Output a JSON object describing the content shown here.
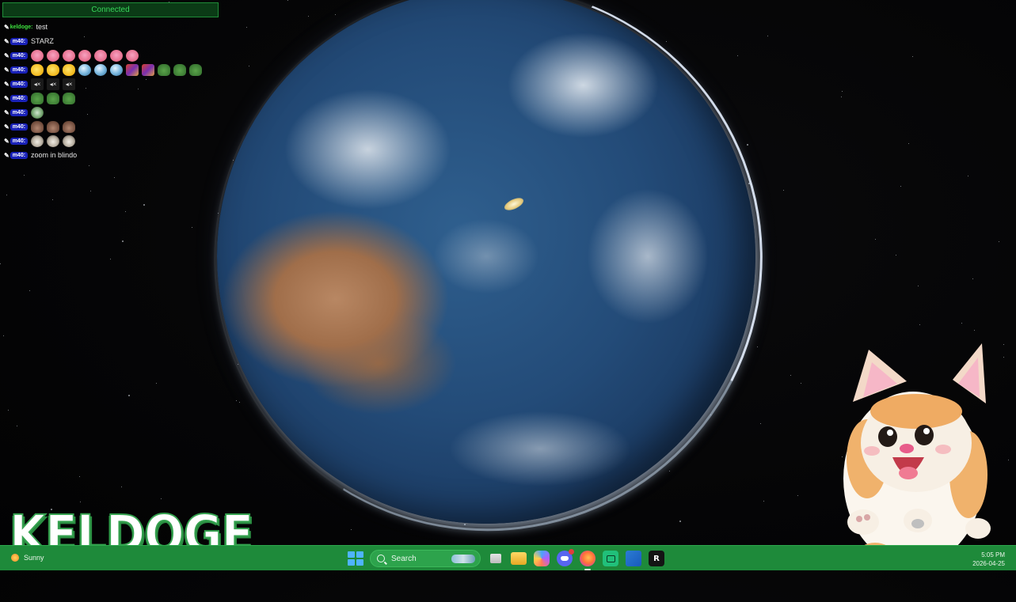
{
  "overlay": {
    "connection_status": "Connected",
    "messages": [
      {
        "user": "keldoge",
        "type": "text",
        "text": "test"
      },
      {
        "user": "m40",
        "type": "text",
        "text": "STARZ"
      },
      {
        "user": "m40",
        "type": "emotes",
        "emotes": [
          "kirby-emote",
          "kirby-emote",
          "kirby-emote",
          "kirby-emote",
          "kirby-emote",
          "kirby-emote",
          "kirby-emote"
        ]
      },
      {
        "user": "m40",
        "type": "emotes",
        "emotes": [
          "yellow-face-emote",
          "yellow-face-emote",
          "yellow-face-emote",
          "glass-sphere-emote",
          "glass-sphere-emote",
          "glass-sphere-emote",
          "mix-emote",
          "mix-emote",
          "frog-emote",
          "frog-emote",
          "frog-emote"
        ]
      },
      {
        "user": "m40",
        "type": "emotes",
        "emotes": [
          "mute-emote",
          "mute-emote",
          "mute-emote"
        ]
      },
      {
        "user": "m40",
        "type": "emotes",
        "emotes": [
          "frog-hand-emote",
          "frog-hand-emote",
          "frog-hand-emote"
        ]
      },
      {
        "user": "m40",
        "type": "emotes",
        "emotes": [
          "hand-emote"
        ]
      },
      {
        "user": "m40",
        "type": "emotes",
        "emotes": [
          "cat-emote",
          "cat-emote",
          "cat-emote"
        ]
      },
      {
        "user": "m40",
        "type": "emotes",
        "emotes": [
          "eye-emote",
          "eye-emote",
          "eye-emote"
        ]
      },
      {
        "user": "m40",
        "type": "text",
        "text": "zoom in blindo"
      }
    ]
  },
  "logo": {
    "text": "KELDOGE"
  },
  "taskbar": {
    "weather": "Sunny",
    "search_label": "Search",
    "icons": [
      "windows-start-icon",
      "search-icon",
      "task-view-icon",
      "file-explorer-icon",
      "copilot-icon",
      "discord-icon",
      "firefox-icon",
      "terminal-icon",
      "word-icon",
      "r-app-icon"
    ],
    "time": "5:05 PM",
    "date": "2026-04-25"
  },
  "colors": {
    "taskbar": "#1e8a3a",
    "connected_text": "#38d85a",
    "username_keldoge": "#3ee33e",
    "username_m40_badge": "#1a22b8"
  }
}
